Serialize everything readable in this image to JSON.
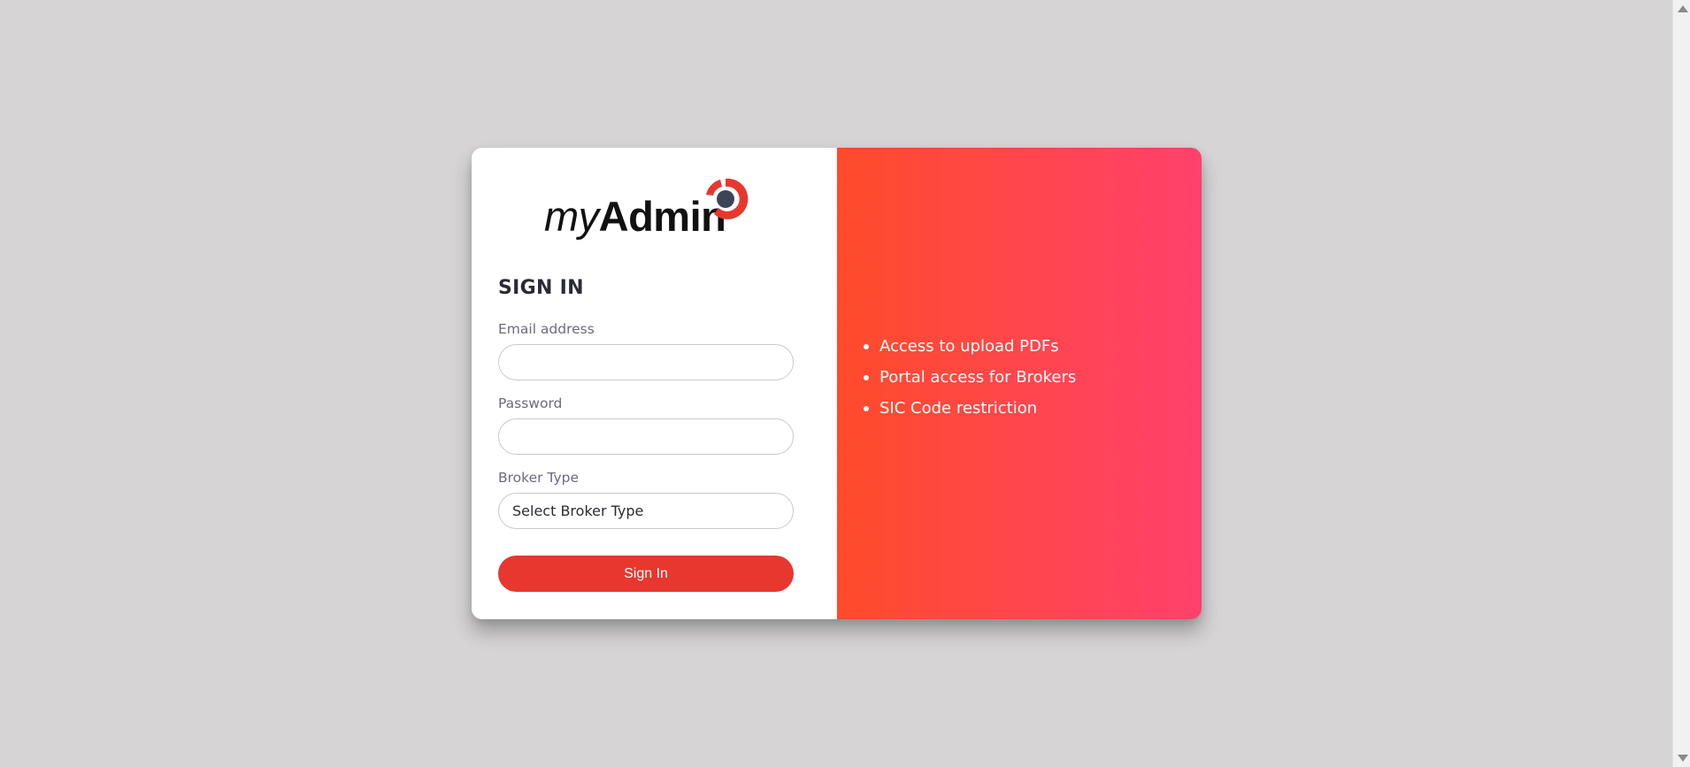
{
  "brand": {
    "logo_prefix": "my",
    "logo_main": "Admin",
    "logo_accent_color": "#e8372e",
    "logo_dot_color": "#3d4457"
  },
  "form": {
    "heading": "SIGN IN",
    "email_label": "Email address",
    "email_value": "",
    "password_label": "Password",
    "password_value": "",
    "broker_type_label": "Broker Type",
    "broker_type_selected": "Select Broker Type",
    "submit_label": "Sign In"
  },
  "features": [
    "Access to upload PDFs",
    "Portal access for Brokers",
    "SIC Code restriction"
  ],
  "colors": {
    "background": "#d6d4d5",
    "gradient_start": "#ff4b2b",
    "gradient_end": "#ff416c",
    "button": "#e8372e"
  }
}
